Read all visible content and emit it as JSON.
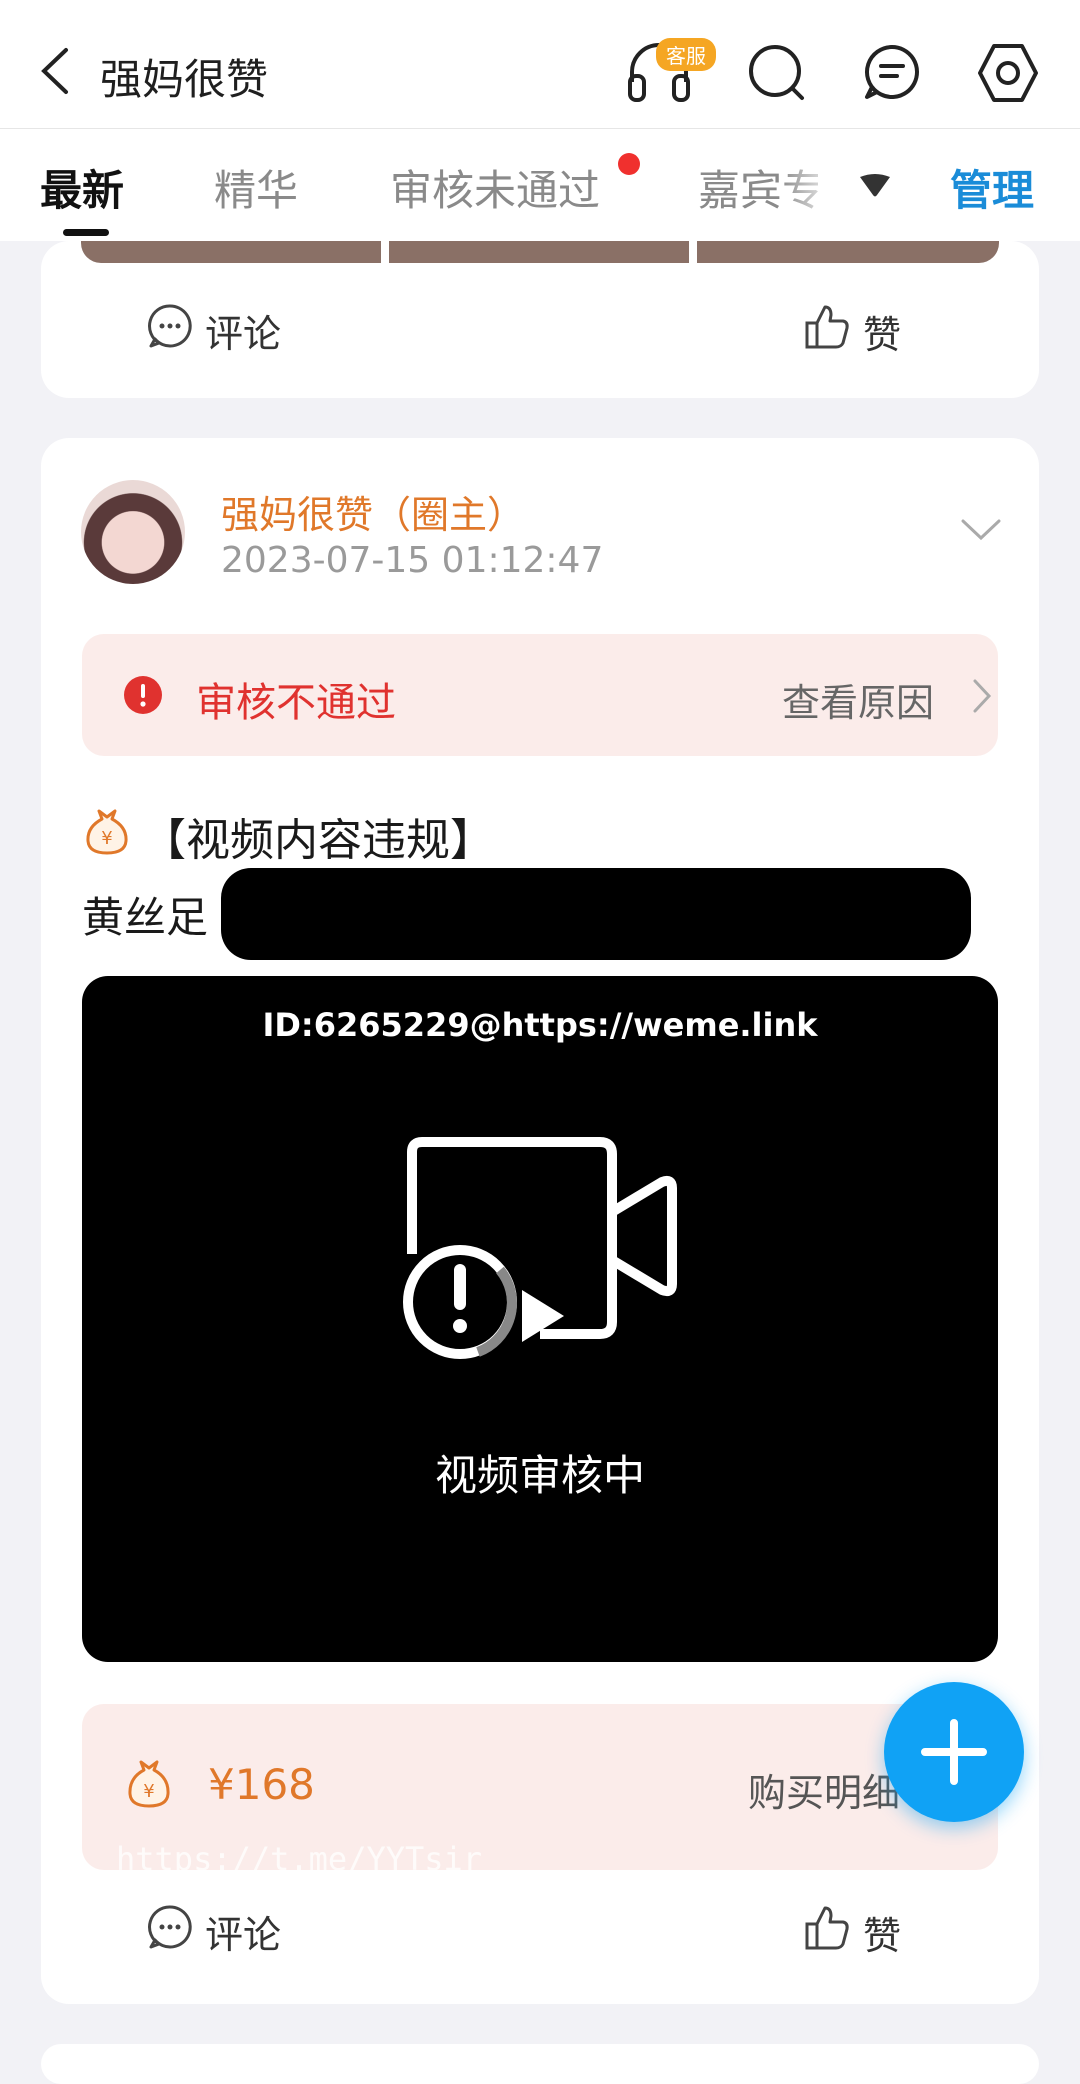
{
  "header": {
    "title": "强妈很赞",
    "support_badge": "客服",
    "icons": [
      "back-icon",
      "headset-icon",
      "search-icon",
      "message-icon",
      "settings-icon"
    ]
  },
  "tabs": [
    {
      "label": "最新",
      "active": true
    },
    {
      "label": "精华",
      "active": false
    },
    {
      "label": "审核未通过",
      "active": false,
      "has_dot": true
    },
    {
      "label": "嘉宾专",
      "active": false
    }
  ],
  "manage_label": "管理",
  "prev_post": {
    "comment_label": "评论",
    "like_label": "赞"
  },
  "post": {
    "author": "强妈很赞（圈主）",
    "timestamp": "2023-07-15 01:12:47",
    "review_status": "审核不通过",
    "view_reason": "查看原因",
    "title": "【视频内容违规】",
    "body": "黄丝足",
    "video": {
      "watermark": "ID:6265229@https://weme.link",
      "status": "视频审核中"
    },
    "price": "¥168",
    "purchase_detail": "购买明细",
    "overlay_text": "https://t.me/YYTsir",
    "comment_label": "评论",
    "like_label": "赞"
  },
  "colors": {
    "accent": "#1a8cd8",
    "author": "#e0782a",
    "error": "#e0322f",
    "fab": "#10a2f5"
  }
}
